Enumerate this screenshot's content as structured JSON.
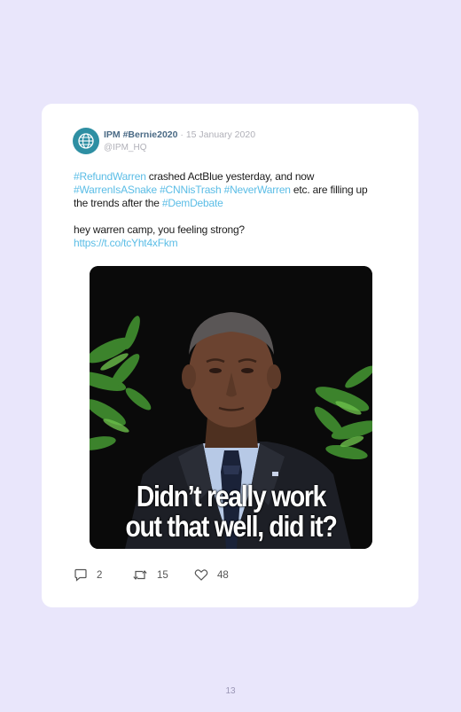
{
  "tweet": {
    "author_name": "IPM #Bernie2020",
    "separator": "·",
    "date": "15 January 2020",
    "handle": "@IPM_HQ",
    "line1": {
      "tag1": "#RefundWarren",
      "text1": " crashed ActBlue yesterday, and now ",
      "tag2": "#WarrenIsASnake",
      "tag3": "#CNNisTrash",
      "tag4": "#NeverWarren",
      "text2": " etc. are filling up the trends after the ",
      "tag5": "#DemDebate"
    },
    "line2": {
      "text": "hey warren camp, you feeling strong?",
      "link": "https://t.co/tcYht4xFkm"
    },
    "media": {
      "caption_line1": "Didn’t really work",
      "caption_line2": "out that well, did it?"
    },
    "actions": {
      "replies": "2",
      "retweets": "15",
      "likes": "48"
    }
  },
  "page_number": "13",
  "colors": {
    "background": "#e9e6fb",
    "card": "#ffffff",
    "link": "#5bbde6",
    "author": "#4a6a85"
  },
  "icons": [
    "globe-icon",
    "reply-icon",
    "retweet-icon",
    "like-icon"
  ]
}
